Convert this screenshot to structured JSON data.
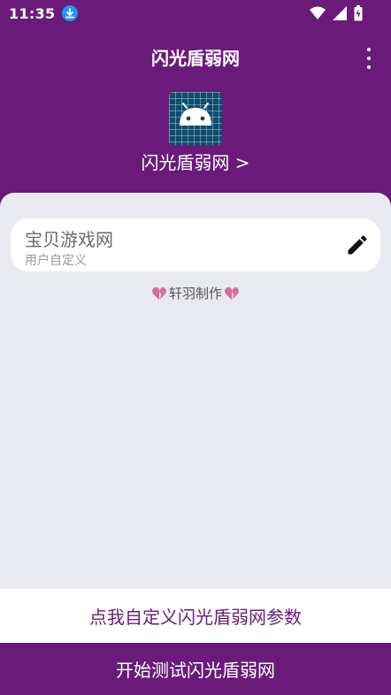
{
  "status_bar": {
    "time": "11:35",
    "icons": [
      "download-icon",
      "wifi-icon",
      "signal-icon",
      "battery-charging-icon"
    ]
  },
  "toolbar": {
    "title": "闪光盾弱网",
    "menu_icon": "more-vert-icon"
  },
  "header": {
    "app_name": "闪光盾弱网 >"
  },
  "card": {
    "title": "宝贝游戏网",
    "subtitle": "用户自定义",
    "action_icon": "edit-icon"
  },
  "credit": {
    "text": "轩羽制作",
    "icon": "broken-heart-icon"
  },
  "buttons": {
    "customize": "点我自定义闪光盾弱网参数",
    "start": "开始测试闪光盾弱网"
  },
  "colors": {
    "primary": "#6a1b7a",
    "panel_bg": "#e9eaf0",
    "card_bg": "#ffffff"
  }
}
